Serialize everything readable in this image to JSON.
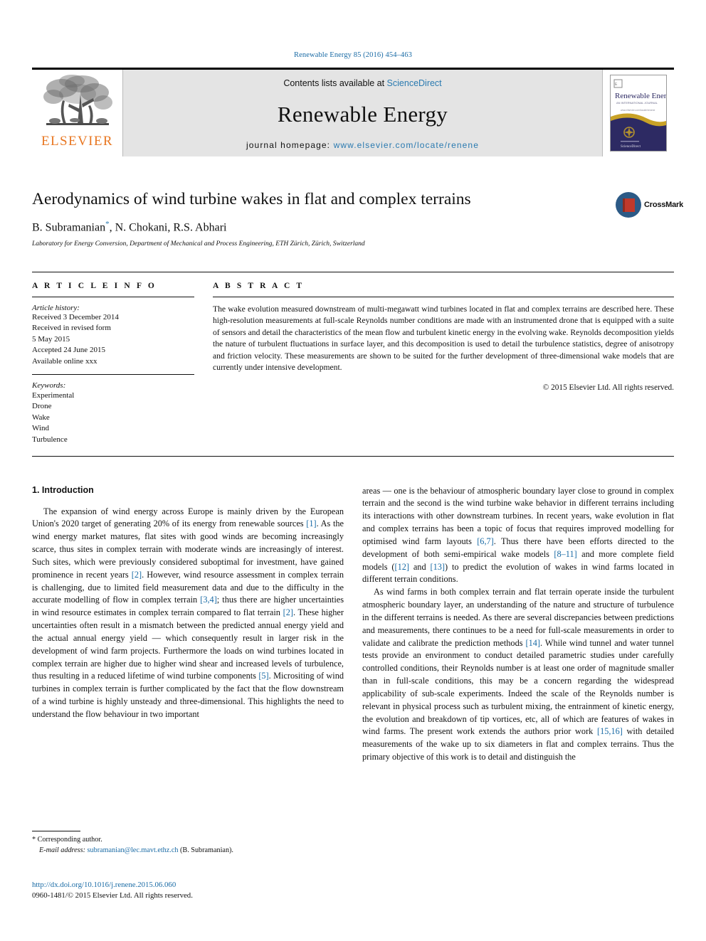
{
  "running_head": "Renewable Energy 85 (2016) 454–463",
  "masthead": {
    "publisher_logo_text": "ELSEVIER",
    "contents_prefix": "Contents lists available at ",
    "contents_link": "ScienceDirect",
    "journal_name": "Renewable Energy",
    "homepage_prefix": "journal homepage: ",
    "homepage_url": "www.elsevier.com/locate/renene",
    "cover": {
      "title": "Renewable Energy",
      "subtitle": "AN INTERNATIONAL JOURNAL"
    }
  },
  "article": {
    "title": "Aerodynamics of wind turbine wakes in flat and complex terrains",
    "authors": "B. Subramanian",
    "authors_rest": ", N. Chokani, R.S. Abhari",
    "corresponding_marker": "*",
    "affiliation": "Laboratory for Energy Conversion, Department of Mechanical and Process Engineering, ETH Zürich, Zürich, Switzerland",
    "crossmark_label": "CrossMark"
  },
  "article_info": {
    "heading": "A R T I C L E   I N F O",
    "history_label": "Article history:",
    "history": [
      "Received 3 December 2014",
      "Received in revised form",
      "5 May 2015",
      "Accepted 24 June 2015",
      "Available online xxx"
    ],
    "keywords_label": "Keywords:",
    "keywords": [
      "Experimental",
      "Drone",
      "Wake",
      "Wind",
      "Turbulence"
    ]
  },
  "abstract": {
    "heading": "A B S T R A C T",
    "text": "The wake evolution measured downstream of multi-megawatt wind turbines located in flat and complex terrains are described here. These high-resolution measurements at full-scale Reynolds number conditions are made with an instrumented drone that is equipped with a suite of sensors and detail the characteristics of the mean flow and turbulent kinetic energy in the evolving wake. Reynolds decomposition yields the nature of turbulent fluctuations in surface layer, and this decomposition is used to detail the turbulence statistics, degree of anisotropy and friction velocity. These measurements are shown to be suited for the further development of three-dimensional wake models that are currently under intensive development.",
    "copyright": "© 2015 Elsevier Ltd. All rights reserved."
  },
  "body": {
    "section_heading": "1. Introduction",
    "left_paragraph_1_a": "The expansion of wind energy across Europe is mainly driven by the European Union's 2020 target of generating 20% of its energy from renewable sources ",
    "ref1": "[1]",
    "left_paragraph_1_b": ". As the wind energy market matures, flat sites with good winds are becoming increasingly scarce, thus sites in complex terrain with moderate winds are increasingly of interest. Such sites, which were previously considered suboptimal for investment, have gained prominence in recent years ",
    "ref2": "[2]",
    "left_paragraph_1_c": ". However, wind resource assessment in complex terrain is challenging, due to limited field measurement data and due to the difficulty in the accurate modelling of flow in complex terrain ",
    "ref34": "[3,4]",
    "left_paragraph_1_d": "; thus there are higher uncertainties in wind resource estimates in complex terrain compared to flat terrain ",
    "ref2b": "[2]",
    "left_paragraph_1_e": ". These higher uncertainties often result in a mismatch between the predicted annual energy yield and the actual annual energy yield — which consequently result in larger risk in the development of wind farm projects. Furthermore the loads on wind turbines located in complex terrain are higher due to higher wind shear and increased levels of turbulence, thus resulting in a reduced lifetime of wind turbine components ",
    "ref5": "[5]",
    "left_paragraph_1_f": ". Micrositing of wind turbines in complex terrain is further complicated by the fact that the flow downstream of a wind turbine is highly unsteady and three-dimensional. This highlights the need to understand the flow behaviour in two important",
    "right_paragraph_1_a": "areas — one is the behaviour of atmospheric boundary layer close to ground in complex terrain and the second is the wind turbine wake behavior in different terrains including its interactions with other downstream turbines. In recent years, wake evolution in flat and complex terrains has been a topic of focus that requires improved modelling for optimised wind farm layouts ",
    "ref67": "[6,7]",
    "right_paragraph_1_b": ". Thus there have been efforts directed to the development of both semi-empirical wake models ",
    "ref811": "[8–11]",
    "right_paragraph_1_c": " and more complete field models (",
    "ref12": "[12]",
    "right_paragraph_1_d": " and ",
    "ref13": "[13]",
    "right_paragraph_1_e": ") to predict the evolution of wakes in wind farms located in different terrain conditions.",
    "right_paragraph_2_a": "As wind farms in both complex terrain and flat terrain operate inside the turbulent atmospheric boundary layer, an understanding of the nature and structure of turbulence in the different terrains is needed. As there are several discrepancies between predictions and measurements, there continues to be a need for full-scale measurements in order to validate and calibrate the prediction methods ",
    "ref14": "[14]",
    "right_paragraph_2_b": ". While wind tunnel and water tunnel tests provide an environment to conduct detailed parametric studies under carefully controlled conditions, their Reynolds number is at least one order of magnitude smaller than in full-scale conditions, this may be a concern regarding the widespread applicability of sub-scale experiments. Indeed the scale of the Reynolds number is relevant in physical process such as turbulent mixing, the entrainment of kinetic energy, the evolution and breakdown of tip vortices, etc, all of which are features of wakes in wind farms. The present work extends the authors prior work ",
    "ref1516": "[15,16]",
    "right_paragraph_2_c": " with detailed measurements of the wake up to six diameters in flat and complex terrains. Thus the primary objective of this work is to detail and distinguish the"
  },
  "footnote": {
    "corresponding": "* Corresponding author.",
    "email_label": "E-mail address:",
    "email": "subramanian@lec.mavt.ethz.ch",
    "email_owner": "(B. Subramanian)."
  },
  "footer": {
    "doi": "http://dx.doi.org/10.1016/j.renene.2015.06.060",
    "issn": "0960-1481/© 2015 Elsevier Ltd. All rights reserved."
  },
  "colors": {
    "link_blue": "#1a6ba5",
    "elsevier_orange": "#E87722",
    "masthead_gray": "#e4e4e4",
    "cover_navy": "#2d2a63",
    "cover_gold": "#c9a227"
  }
}
